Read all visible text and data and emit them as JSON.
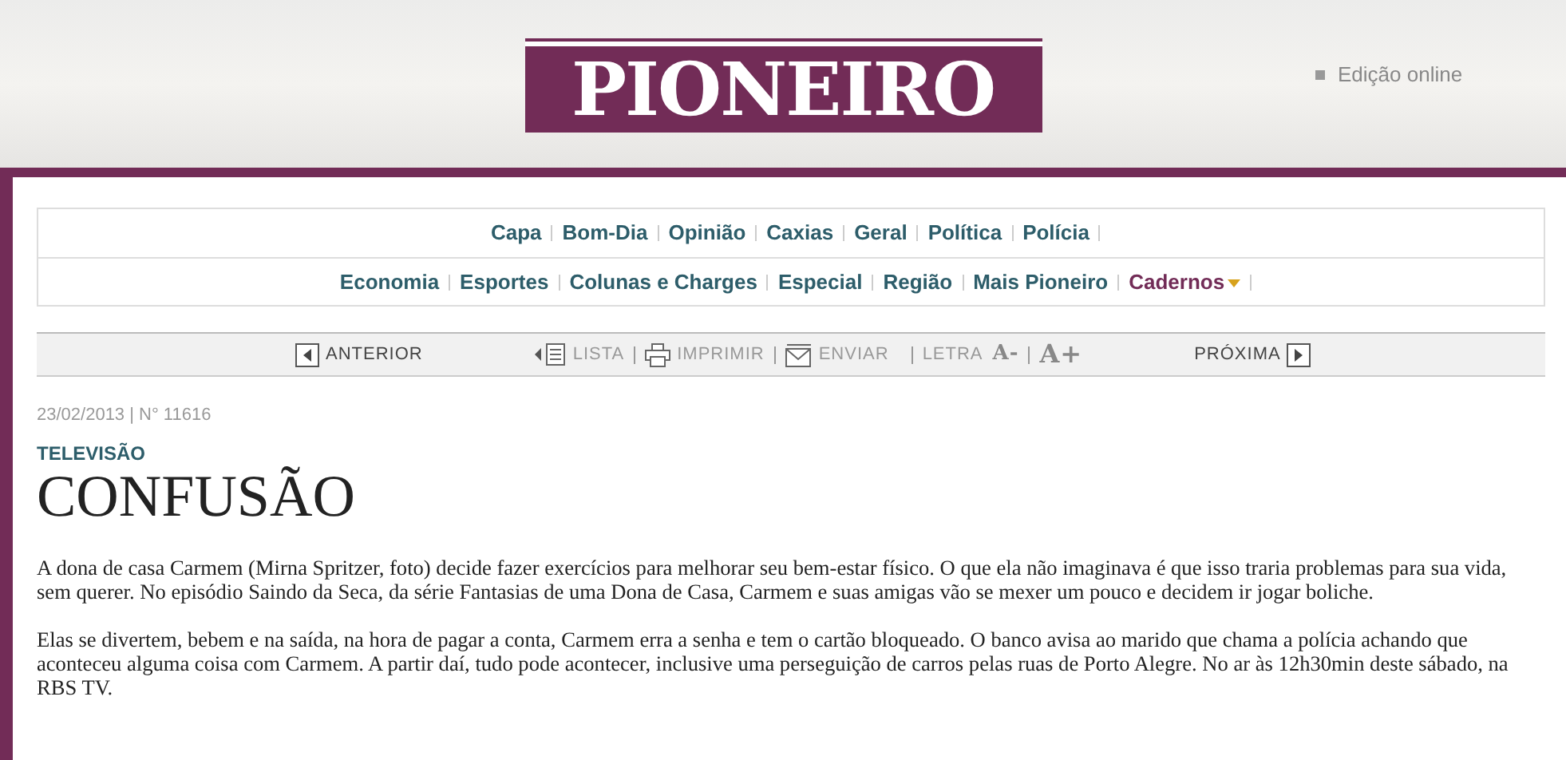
{
  "header": {
    "logo": "PIONEIRO",
    "edition_link": "Edição online"
  },
  "nav_rows": [
    {
      "items": [
        {
          "label": "Capa",
          "kind": "link"
        },
        {
          "label": "Bom-Dia",
          "kind": "link"
        },
        {
          "label": "Opinião",
          "kind": "link"
        },
        {
          "label": "Caxias",
          "kind": "link"
        },
        {
          "label": "Geral",
          "kind": "link"
        },
        {
          "label": "Política",
          "kind": "link"
        },
        {
          "label": "Polícia",
          "kind": "link"
        }
      ]
    },
    {
      "items": [
        {
          "label": "Economia",
          "kind": "link"
        },
        {
          "label": "Esportes",
          "kind": "link"
        },
        {
          "label": "Colunas e Charges",
          "kind": "link"
        },
        {
          "label": "Especial",
          "kind": "link"
        },
        {
          "label": "Região",
          "kind": "link"
        },
        {
          "label": "Mais Pioneiro",
          "kind": "link"
        },
        {
          "label": "Cadernos",
          "kind": "dropdown"
        }
      ]
    }
  ],
  "toolbar": {
    "previous": "ANTERIOR",
    "list": "LISTA",
    "print": "IMPRIMIR",
    "send": "ENVIAR",
    "font_label": "LETRA",
    "font_smaller": "A-",
    "font_larger": "A+",
    "next": "PRÓXIMA"
  },
  "article": {
    "meta": "23/02/2013 | N° 11616",
    "section": "TELEVISÃO",
    "title": "CONFUSÃO",
    "paragraphs": [
      "A dona de casa Carmem (Mirna Spritzer, foto) decide fazer exercícios para melhorar seu bem-estar físico. O que ela não imaginava é que isso traria problemas para sua vida, sem querer. No episódio Saindo da Seca, da série Fantasias de uma Dona de Casa, Carmem e suas amigas vão se mexer um pouco e decidem ir jogar boliche.",
      "Elas se divertem, bebem e na saída, na hora de pagar a conta, Carmem erra a senha e tem o cartão bloqueado. O banco avisa ao marido que chama a polícia achando que aconteceu alguma coisa com Carmem. A partir daí, tudo pode acontecer, inclusive uma perseguição de carros pelas ruas de Porto Alegre. No ar às 12h30min deste sábado, na RBS TV."
    ]
  }
}
